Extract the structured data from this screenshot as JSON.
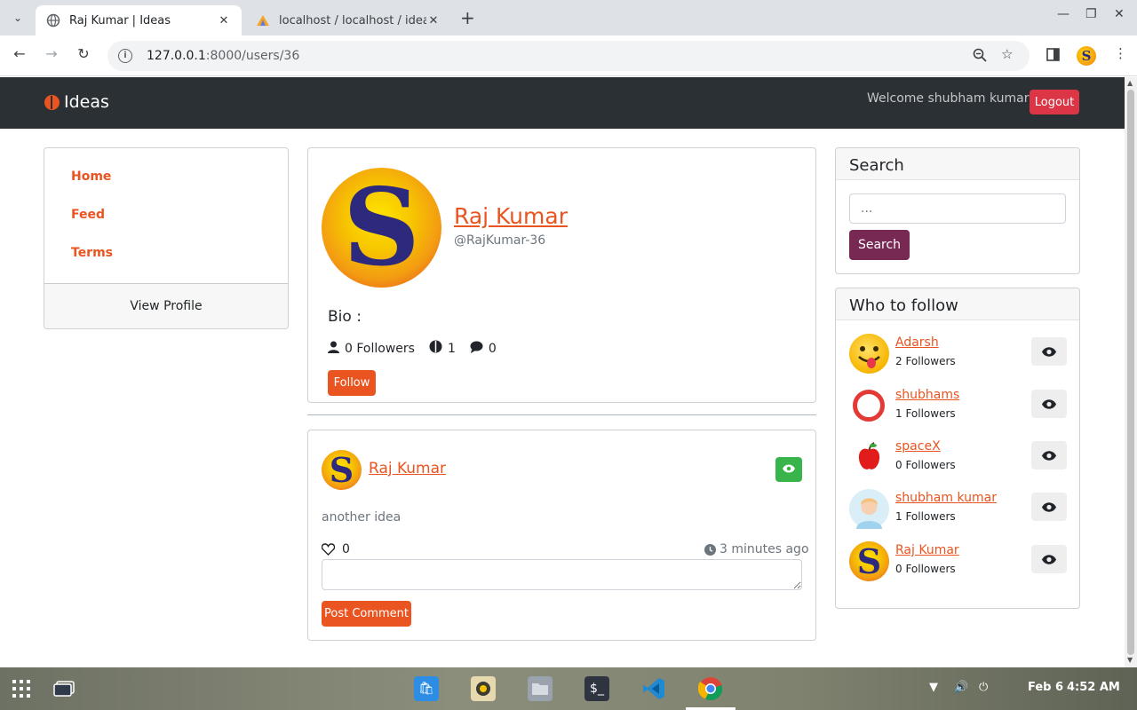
{
  "browser": {
    "tabs": [
      {
        "title": "Raj Kumar | Ideas",
        "active": true
      },
      {
        "title": "localhost / localhost / idea",
        "active": false
      }
    ],
    "url_host": "127.0.0.1",
    "url_path": ":8000/users/36"
  },
  "nav": {
    "brand": "Ideas",
    "welcome": "Welcome shubham kumar",
    "logout": "Logout"
  },
  "sidebar": {
    "items": [
      "Home",
      "Feed",
      "Terms"
    ],
    "view_profile": "View Profile"
  },
  "profile": {
    "name": "Raj Kumar",
    "handle": "@RajKumar-36",
    "avatar_letter": "S",
    "bio_label": "Bio :",
    "followers": "0 Followers",
    "ideas": "1",
    "comments": "0",
    "follow_label": "Follow"
  },
  "idea": {
    "author": "Raj Kumar",
    "content": "another idea",
    "likes": "0",
    "time": "3 minutes ago",
    "post_comment": "Post Comment"
  },
  "search": {
    "title": "Search",
    "placeholder": "...",
    "button": "Search"
  },
  "who_to_follow": {
    "title": "Who to follow",
    "users": [
      {
        "name": "Adarsh",
        "followers": "2 Followers"
      },
      {
        "name": "shubhams",
        "followers": "1 Followers"
      },
      {
        "name": "spaceX",
        "followers": "0 Followers"
      },
      {
        "name": "shubham kumar",
        "followers": "1 Followers"
      },
      {
        "name": "Raj Kumar",
        "followers": "0 Followers"
      }
    ]
  },
  "taskbar": {
    "date": "Feb 6",
    "time": "4:52 AM"
  },
  "colors": {
    "primary": "#e95420",
    "navbar": "#2b3035",
    "danger": "#dc3545",
    "success": "#38b44a",
    "search_button": "#772953"
  }
}
